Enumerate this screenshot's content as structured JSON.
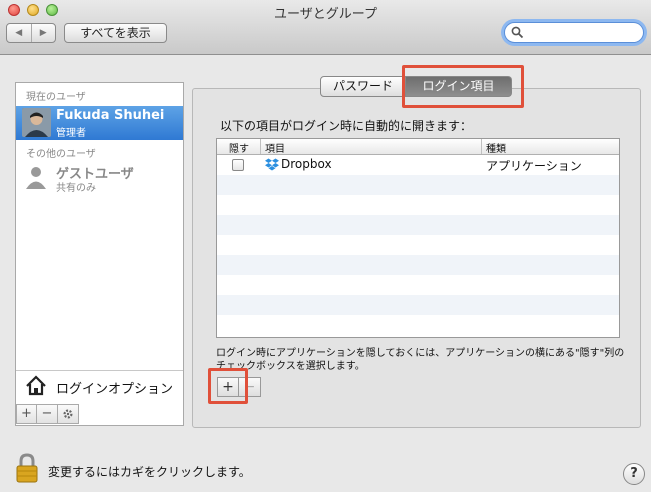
{
  "window": {
    "title": "ユーザとグループ"
  },
  "toolbar": {
    "back_glyph": "◀",
    "forward_glyph": "▶",
    "show_all": "すべてを表示",
    "search_placeholder": ""
  },
  "sidebar": {
    "current_section": "現在のユーザ",
    "current_user": {
      "name": "Fukuda Shuhei",
      "role": "管理者"
    },
    "other_section": "その他のユーザ",
    "guest": {
      "name": "ゲストユーザ",
      "role": "共有のみ"
    },
    "login_options": "ログインオプション",
    "add": "+",
    "remove": "−"
  },
  "tabs": {
    "password": "パスワード",
    "login_items": "ログイン項目"
  },
  "login_items": {
    "intro": "以下の項目がログイン時に自動的に開きます：",
    "columns": {
      "hide": "隠す",
      "item": "項目",
      "kind": "種類"
    },
    "rows": [
      {
        "hide": false,
        "name": "Dropbox",
        "kind": "アプリケーション",
        "icon": "dropbox-icon"
      }
    ],
    "help": "ログイン時にアプリケーションを隠しておくには、アプリケーションの横にある\"隠す\"列のチェックボックスを選択します。",
    "add": "+",
    "remove": "−"
  },
  "footer": {
    "lock_text": "変更するにはカギをクリックします。",
    "help": "?"
  },
  "colors": {
    "selection": "#3a84d9",
    "highlight": "#e0503a"
  }
}
